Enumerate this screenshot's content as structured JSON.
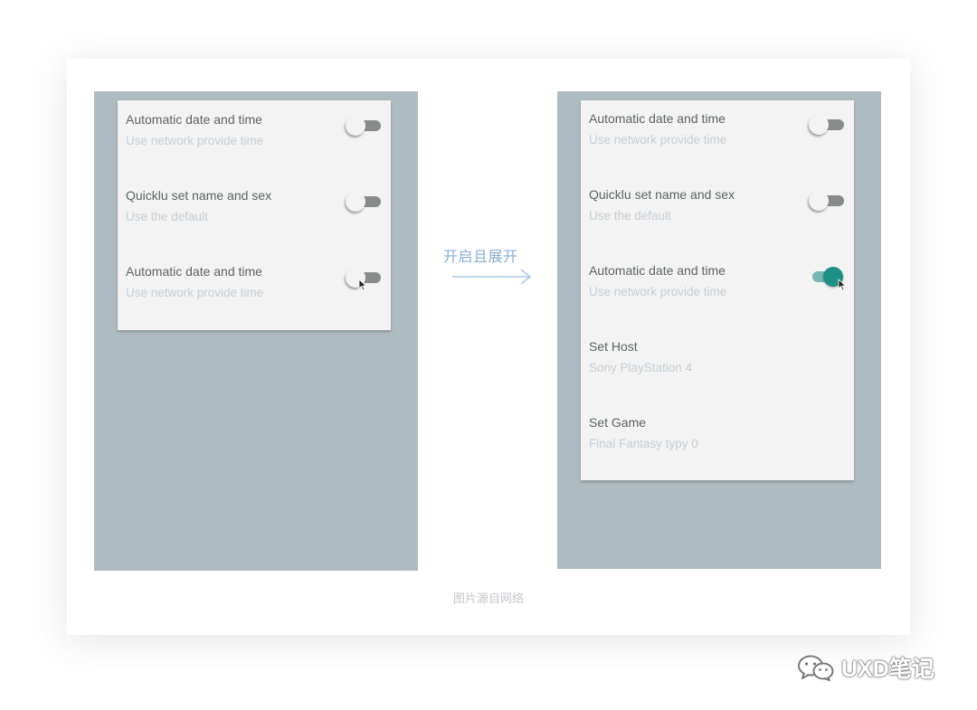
{
  "left_screen": {
    "rows": [
      {
        "title": "Automatic date and time",
        "subtitle": "Use network provide time",
        "toggle": "off"
      },
      {
        "title": "Quicklu set name and sex",
        "subtitle": "Use the default",
        "toggle": "off"
      },
      {
        "title": "Automatic date and time",
        "subtitle": "Use network provide time",
        "toggle": "off"
      }
    ]
  },
  "transition": {
    "label": "开启且展开"
  },
  "right_screen": {
    "rows": [
      {
        "title": "Automatic date and time",
        "subtitle": "Use network provide time",
        "toggle": "off"
      },
      {
        "title": "Quicklu set name and sex",
        "subtitle": "Use the default",
        "toggle": "off"
      },
      {
        "title": "Automatic date and time",
        "subtitle": "Use network provide time",
        "toggle": "on"
      },
      {
        "title": "Set Host",
        "subtitle": "Sony PlayStation 4"
      },
      {
        "title": "Set Game",
        "subtitle": "Final Fantasy typy 0"
      }
    ]
  },
  "caption": "图片源自网络",
  "watermark": {
    "text": "UXD笔记",
    "icon": "wechat-icon"
  },
  "colors": {
    "toggle_on": "#1e8f84",
    "toggle_off": "#888b8c",
    "screen_bg": "#aebbc1",
    "panel_bg": "#f2f3f2"
  }
}
